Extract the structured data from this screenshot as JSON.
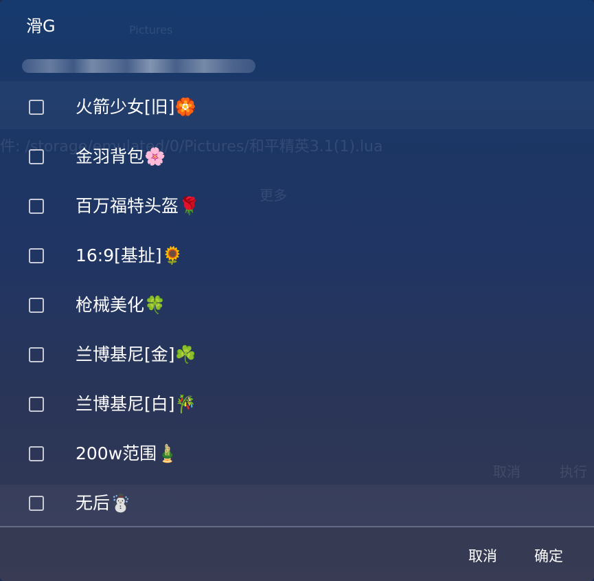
{
  "dialog": {
    "title": "滑G",
    "items": [
      {
        "label": "火箭少女[旧]🏵️",
        "checked": false
      },
      {
        "label": "金羽背包🌸",
        "checked": false
      },
      {
        "label": "百万福特头盔🌹",
        "checked": false
      },
      {
        "label": "16:9[基扯]🌻",
        "checked": false
      },
      {
        "label": "枪械美化🍀",
        "checked": false
      },
      {
        "label": "兰博基尼[金]☘️",
        "checked": false
      },
      {
        "label": "兰博基尼[白]🎋",
        "checked": false
      },
      {
        "label": "200w范围🎍",
        "checked": false
      },
      {
        "label": "无后☃️",
        "checked": false
      }
    ],
    "cancel_label": "取消",
    "confirm_label": "确定"
  },
  "background": {
    "tab_text": "Pictures",
    "path_text": "件: /storage/emulated/0/Pictures/和平精英3.1(1).lua",
    "more_text": "更多",
    "cancel_text": "取消",
    "execute_text": "执行"
  },
  "colors": {
    "text": "#ffffff",
    "checkbox_border": "#c9ccd6",
    "divider": "#8c96af"
  }
}
